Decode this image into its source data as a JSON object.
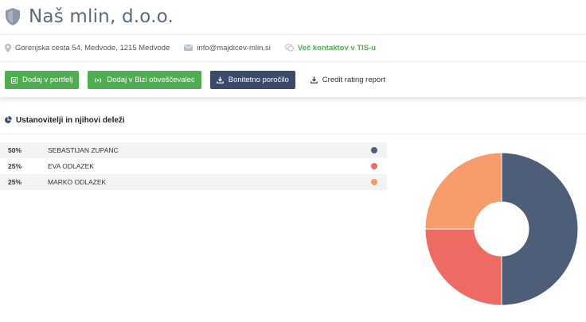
{
  "company": {
    "name": "Naš mlin, d.o.o."
  },
  "contact": {
    "address": "Gorenjska cesta 54, Medvode, 1215 Medvode",
    "email": "info@majdicev-mlin.si",
    "more_contacts": "Več kontaktov v TIS-u"
  },
  "actions": {
    "add_portfolio": "Dodaj v portfelj",
    "add_bizi": "Dodaj v Bizi obveščevalec",
    "credit_report": "Bonitetno poročilo",
    "credit_rating": "Credit rating report"
  },
  "founders": {
    "section_title": "Ustanovitelji in njihovi deleži",
    "rows": [
      {
        "share": "50%",
        "name": "SEBASTIJAN ZUPANC",
        "color": "#4e5d78"
      },
      {
        "share": "25%",
        "name": "EVA ODLAZEK",
        "color": "#ee6b63"
      },
      {
        "share": "25%",
        "name": "MARKO ODLAZEK",
        "color": "#f59c6a"
      }
    ]
  },
  "colors": {
    "green": "#4cae4f",
    "navy": "#3b4a6b",
    "icon_gray": "#b7bfc9"
  },
  "chart_data": {
    "type": "pie",
    "categories": [
      "SEBASTIJAN ZUPANC",
      "EVA ODLAZEK",
      "MARKO ODLAZEK"
    ],
    "values": [
      50,
      25,
      25
    ],
    "colors": [
      "#4e5d78",
      "#ee6b63",
      "#f59c6a"
    ],
    "donut": true
  }
}
